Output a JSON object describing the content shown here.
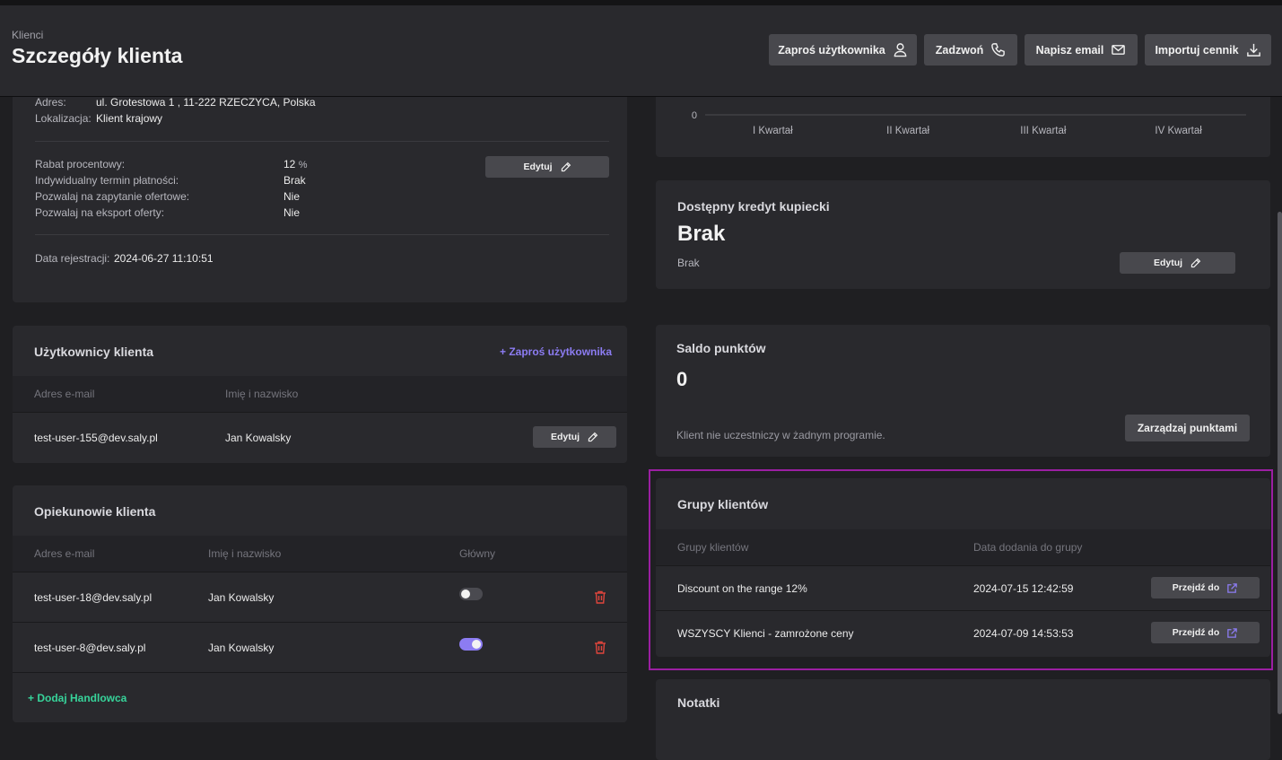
{
  "header": {
    "breadcrumb": "Klienci",
    "title": "Szczegóły klienta",
    "buttons": {
      "invite": "Zaproś użytkownika",
      "call": "Zadzwoń",
      "email": "Napisz email",
      "import": "Importuj cennik"
    }
  },
  "client_info": {
    "address_label": "Adres:",
    "address_value": "ul. Grotestowa 1 , 11-222 RZECZYCA, Polska",
    "location_label": "Lokalizacja:",
    "location_value": "Klient krajowy",
    "discount_label": "Rabat procentowy:",
    "discount_value": "12",
    "discount_unit": "%",
    "payment_label": "Indywidualny termin płatności:",
    "payment_value": "Brak",
    "rfq_label": "Pozwalaj na zapytanie ofertowe:",
    "rfq_value": "Nie",
    "export_label": "Pozwalaj na eksport oferty:",
    "export_value": "Nie",
    "edit_label": "Edytuj",
    "registered_label": "Data rejestracji:",
    "registered_value": "2024-06-27 11:10:51"
  },
  "users": {
    "title": "Użytkownicy klienta",
    "invite_link": "+ Zaproś użytkownika",
    "col_email": "Adres e-mail",
    "col_name": "Imię i nazwisko",
    "rows": [
      {
        "email": "test-user-155@dev.saly.pl",
        "name": "Jan Kowalsky",
        "edit": "Edytuj"
      }
    ]
  },
  "caretakers": {
    "title": "Opiekunowie klienta",
    "col_email": "Adres e-mail",
    "col_name": "Imię i nazwisko",
    "col_main": "Główny",
    "rows": [
      {
        "email": "test-user-18@dev.saly.pl",
        "name": "Jan Kowalsky",
        "main": false
      },
      {
        "email": "test-user-8@dev.saly.pl",
        "name": "Jan Kowalsky",
        "main": true
      }
    ],
    "add_link": "+ Dodaj Handlowca"
  },
  "chart_data": {
    "type": "bar",
    "categories": [
      "I Kwartał",
      "II Kwartał",
      "III Kwartał",
      "IV Kwartał"
    ],
    "series": [],
    "y_ticks": [
      "0"
    ],
    "title": "",
    "xlabel": "",
    "ylabel": ""
  },
  "credit": {
    "title": "Dostępny kredyt kupiecki",
    "value": "Brak",
    "sub": "Brak",
    "edit_label": "Edytuj"
  },
  "points": {
    "title": "Saldo punktów",
    "value": "0",
    "note": "Klient nie uczestniczy w żadnym programie.",
    "manage_button": "Zarządzaj punktami"
  },
  "groups": {
    "title": "Grupy klientów",
    "col_group": "Grupy klientów",
    "col_date": "Data dodania do grupy",
    "rows": [
      {
        "name": "Discount on the range 12%",
        "date": "2024-07-15 12:42:59",
        "action": "Przejdź do"
      },
      {
        "name": "WSZYSCY Klienci - zamrożone ceny",
        "date": "2024-07-09 14:53:53",
        "action": "Przejdź do"
      }
    ]
  },
  "notes": {
    "title": "Notatki"
  },
  "colors": {
    "accent_purple": "#8c7cf2",
    "accent_green": "#37d39a",
    "danger_red": "#e0453c",
    "highlight": "#9b1fa2"
  }
}
